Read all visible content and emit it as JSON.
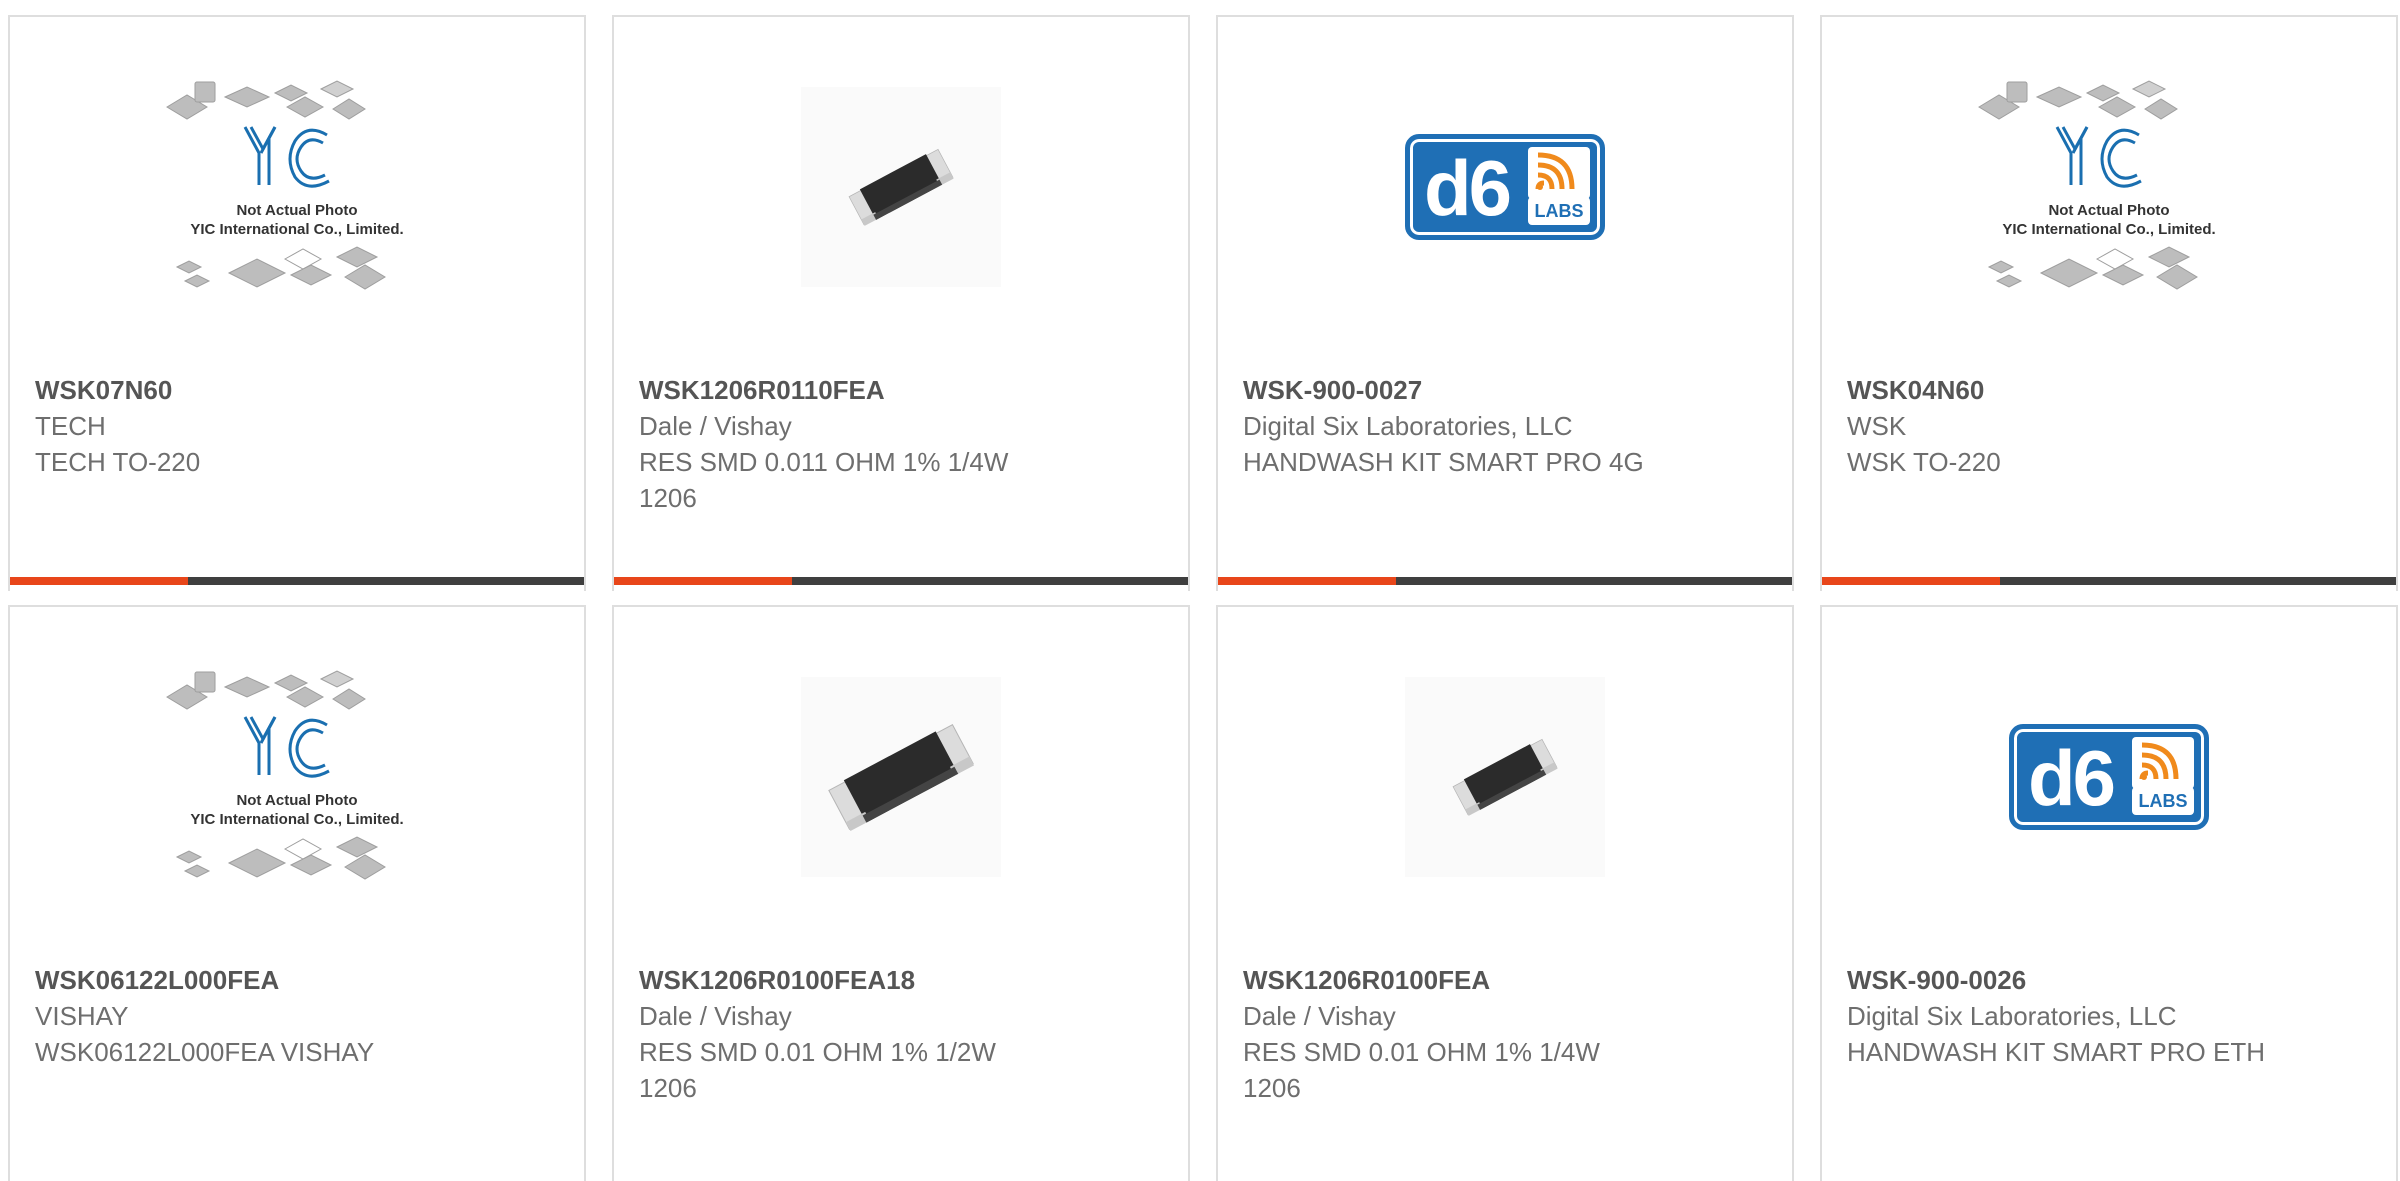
{
  "accent_color": "#e8461a",
  "bar_color": "#3f3f3f",
  "accent_fraction": 0.31,
  "placeholder_text": {
    "line1": "Not Actual Photo",
    "line2": "YIC International Co., Limited.",
    "logo": "YIC"
  },
  "d6_logo": {
    "main": "d6",
    "sub": "LABS"
  },
  "products": [
    {
      "part_number": "WSK07N60",
      "manufacturer": "TECH",
      "description": "TECH TO-220",
      "image": "yic-placeholder"
    },
    {
      "part_number": "WSK1206R0110FEA",
      "manufacturer": "Dale / Vishay",
      "description": "RES SMD 0.011 OHM 1% 1/4W 1206",
      "image": "smd-resistor"
    },
    {
      "part_number": "WSK-900-0027",
      "manufacturer": "Digital Six Laboratories, LLC",
      "description": "HANDWASH KIT SMART PRO 4G",
      "image": "d6-labs-logo"
    },
    {
      "part_number": "WSK04N60",
      "manufacturer": "WSK",
      "description": "WSK TO-220",
      "image": "yic-placeholder"
    },
    {
      "part_number": "WSK06122L000FEA",
      "manufacturer": "VISHAY",
      "description": "WSK06122L000FEA VISHAY",
      "image": "yic-placeholder"
    },
    {
      "part_number": "WSK1206R0100FEA18",
      "manufacturer": "Dale / Vishay",
      "description": "RES SMD 0.01 OHM 1% 1/2W 1206",
      "image": "smd-resistor-large"
    },
    {
      "part_number": "WSK1206R0100FEA",
      "manufacturer": "Dale / Vishay",
      "description": "RES SMD 0.01 OHM 1% 1/4W 1206",
      "image": "smd-resistor"
    },
    {
      "part_number": "WSK-900-0026",
      "manufacturer": "Digital Six Laboratories, LLC",
      "description": "HANDWASH KIT SMART PRO ETH",
      "image": "d6-labs-logo"
    }
  ]
}
